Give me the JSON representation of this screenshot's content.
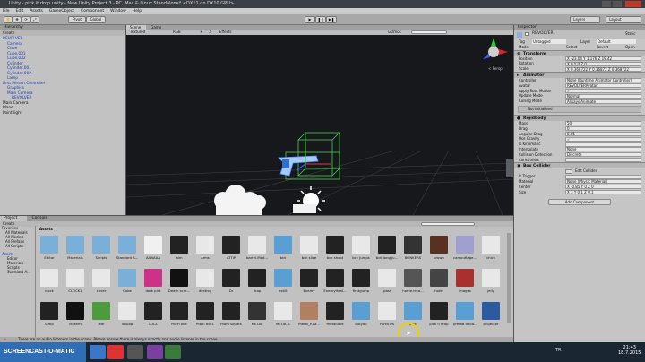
{
  "window": {
    "title": "Unity - pick it drop.unity - New Unity Project 3 - PC, Mac & Linux Standalone* <DX11 on DX10 GPU>"
  },
  "menu": [
    "File",
    "Edit",
    "Assets",
    "GameObject",
    "Component",
    "Window",
    "Help"
  ],
  "toolbar": {
    "pivot": "Pivot",
    "global": "Global",
    "layers": "Layers",
    "layout": "Layout"
  },
  "hierarchy": {
    "title": "Hierarchy",
    "create": "Create",
    "items": [
      {
        "label": "REVOLVER",
        "indent": 0,
        "blue": true
      },
      {
        "label": "Camera",
        "indent": 1,
        "blue": true
      },
      {
        "label": "Cube",
        "indent": 1,
        "blue": true
      },
      {
        "label": "Cube.001",
        "indent": 1,
        "blue": true
      },
      {
        "label": "Cube.002",
        "indent": 1,
        "blue": true
      },
      {
        "label": "Cylinder",
        "indent": 1,
        "blue": true
      },
      {
        "label": "Cylinder.001",
        "indent": 1,
        "blue": true
      },
      {
        "label": "Cylinder.002",
        "indent": 1,
        "blue": true
      },
      {
        "label": "Lamp",
        "indent": 1,
        "blue": true
      },
      {
        "label": "First Person Controller",
        "indent": 0,
        "blue": true
      },
      {
        "label": "Graphics",
        "indent": 1,
        "blue": true
      },
      {
        "label": "Main Camera",
        "indent": 1,
        "blue": true
      },
      {
        "label": "REVOLVER",
        "indent": 2,
        "blue": true
      },
      {
        "label": "Main Camera",
        "indent": 0,
        "blue": false
      },
      {
        "label": "Plane",
        "indent": 0,
        "blue": false
      },
      {
        "label": "Point light",
        "indent": 0,
        "blue": false
      }
    ]
  },
  "scene": {
    "tabs": [
      "Scene",
      "Game"
    ],
    "shading": "Textured",
    "mode": "RGB",
    "effects": "Effects",
    "gizmos": "Gizmos",
    "persp": "< Persp"
  },
  "inspector": {
    "title": "Inspector",
    "object_name": "REVOLVER",
    "static": "Static",
    "tag_label": "Tag",
    "tag": "Untagged",
    "layer_label": "Layer",
    "layer": "Default",
    "model": "Model",
    "select": "Select",
    "revert": "Revert",
    "open": "Open",
    "transform": {
      "title": "Transform",
      "rows": [
        {
          "label": "Position",
          "value": "X -23.04   Y 1.176   Z 19.42"
        },
        {
          "label": "Rotation",
          "value": "X 0   Y 0   Z 0"
        },
        {
          "label": "Scale",
          "value": "X 0.368722   Y 0.36872   Z 0.368722"
        }
      ]
    },
    "animator": {
      "title": "Animator",
      "rows": [
        {
          "label": "Controller",
          "value": "None (Runtime Animator Controller)"
        },
        {
          "label": "Avatar",
          "value": "REVOLVERAvatar"
        },
        {
          "label": "Apply Root Motion",
          "value": "✓"
        },
        {
          "label": "Update Mode",
          "value": "Normal"
        },
        {
          "label": "Culling Mode",
          "value": "Always Animate"
        }
      ],
      "note": "Not initialized"
    },
    "rigidbody": {
      "title": "Rigidbody",
      "rows": [
        {
          "label": "Mass",
          "value": "50"
        },
        {
          "label": "Drag",
          "value": "0"
        },
        {
          "label": "Angular Drag",
          "value": "0.05"
        },
        {
          "label": "Use Gravity",
          "value": "✓"
        },
        {
          "label": "Is Kinematic",
          "value": ""
        },
        {
          "label": "Interpolate",
          "value": "None"
        },
        {
          "label": "Collision Detection",
          "value": "Discrete"
        },
        {
          "label": "Constraints",
          "value": ""
        }
      ]
    },
    "box_collider": {
      "title": "Box Collider",
      "edit": "Edit Collider",
      "rows": [
        {
          "label": "Is Trigger",
          "value": ""
        },
        {
          "label": "Material",
          "value": "None (Physic Material)"
        },
        {
          "label": "Center",
          "value": "X -0.85   Y 0   Z 0"
        },
        {
          "label": "Size",
          "value": "X 3   Y 0.1   Z 0.1"
        }
      ]
    },
    "add_component": "Add Component"
  },
  "project": {
    "tabs": [
      "Project",
      "Console"
    ],
    "create": "Create",
    "favorites": [
      "Favorites",
      "All Materials",
      "All Models",
      "All Prefabs",
      "All Scripts"
    ],
    "assets_tree": [
      "Assets",
      "Editor",
      "Materials",
      "Scripts",
      "Standard A..."
    ],
    "breadcrumb": "Assets",
    "assets": [
      [
        "Editor",
        "Materials",
        "Scripts",
        "Standard A...",
        "AAAAAA",
        "aim",
        "arms",
        "ATTIP",
        "barrel-Mod...",
        "bck",
        "bck slice",
        "bck shoot",
        "bck jumps",
        "bck long ju...",
        "BONKERS",
        "brown",
        "camouflage...",
        "chick"
      ],
      [
        "clock",
        "CLOCK1",
        "cover",
        "Cube",
        "dark pint",
        "Death scre...",
        "destroy",
        "Dr",
        "drop",
        "exkit",
        "Enemy",
        "EnemyHeal...",
        "firstgump",
        "glass",
        "home-trea...",
        "hotel",
        "images",
        "jelly"
      ],
      [
        "lamp",
        "lantern",
        "leaf",
        "lolipop",
        "LOLZ",
        "main bck",
        "main bck1",
        "mom squats",
        "METAL",
        "METAL 1",
        "metal_rust...",
        "metaltake",
        "outyou",
        "Particles",
        "pick",
        "pick n drop",
        "prefab tecto...",
        "projector"
      ]
    ]
  },
  "status": "There are no audio listeners in the scene. Please ensure there is always exactly one audio listener in the scene.",
  "taskbar": {
    "time": "21:43",
    "date": "18.7.2015",
    "lang": "TR"
  },
  "watermark": "SCREENCAST-O-MATIC",
  "colors": {
    "accent_blue": "#1a3db0",
    "dark_bg": "#15171a",
    "gizmo_green": "#4cd04c"
  }
}
